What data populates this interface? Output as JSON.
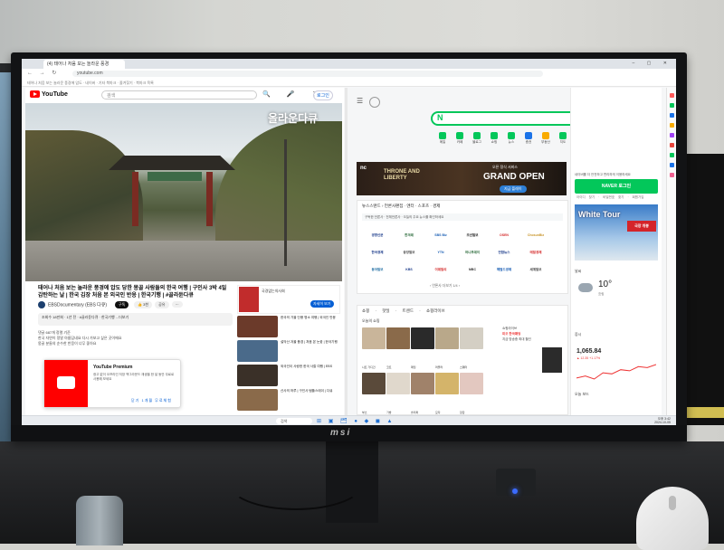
{
  "browser": {
    "tab_title": "(4) 태어나 처음 보는 놀라운 풍경",
    "url": "youtube.com",
    "window_controls": "– ▢ ✕",
    "nav_glyphs": "← → ↻",
    "bookmarks": "테어나 처음 보는 놀라운 풍경에 압도 · 네이버 · 기타 북마크 · 즐겨찾기 · 북마크 목록"
  },
  "youtube": {
    "logo": "YouTube",
    "search_placeholder": "검색",
    "icons": "🔍 🎤 ⋮",
    "login": "로그인",
    "video_overlay": "올라운다큐",
    "video_title": "태어나 처음 보는 놀라운 풍경에 압도 당한 몽골 사람들의 한국 여행 | 구인사 3박 4일 감탄하는 날 | 한국 김장 처음 본 외국인 반응 | 한국기행 | #골라듄다큐",
    "channel_name": "EBSDocumentary (EBS 다큐)",
    "subscribe": "구독",
    "actions": [
      "👍 3천",
      "공유",
      "⋯"
    ],
    "description": "조회수 18만회 · 1년 전 · #골라듄다큐 · 한국기행 ...더보기",
    "comment_lines": [
      "댓글 687개  정렬 기준",
      "한국 자연이 정말 아름답네요 다시 가보고 싶은 곳이에요",
      "몽골 분들의 순수한 반응이 너무 좋아요"
    ],
    "premium": {
      "title": "YouTube Premium",
      "text": "광고 없이 오프라인 저장 백그라운드 재생을 한 달 동안 무료로 사용해 보세요",
      "buttons": "닫기  1개월 무료체험"
    },
    "side_ad": {
      "title": "국경없는의사회",
      "button": "자세히 보기"
    },
    "recommendations": [
      {
        "title": "한국의 가을 단풍 명소 여행 | 외국인 반응",
        "thumb": "#6b3a2a"
      },
      {
        "title": "설악산 겨울 풍경 | 처음 본 눈꽃 | 한국기행",
        "thumb": "#4a6a8a"
      },
      {
        "title": "외국인이 사랑한 한국 사찰 여행 | EBS",
        "thumb": "#3a3028"
      },
      {
        "title": "산사의 하루 | 구인사 템플스테이 | 다큐",
        "thumb": "#8a6a4a"
      }
    ]
  },
  "naver": {
    "search_logo": "N",
    "shortcuts": [
      "메일",
      "카페",
      "블로그",
      "쇼핑",
      "뉴스",
      "증권",
      "부동산",
      "지도",
      "웹툰"
    ],
    "banner": {
      "brand": "nc",
      "game": "THRONE AND LIBERTY",
      "subtitle": "오픈 정식 서비스",
      "headline": "GRAND OPEN",
      "button": "지금 플레이"
    },
    "news_header": "뉴스스탠드 › 언론사편집 · 엔터 · 스포츠 · 경제",
    "news_subline": "구독한 언론사 · 전체언론사 · 오늘의 주요 뉴스를 확인하세요",
    "news_pager": "‹ 언론사 더보기 1/4 ›",
    "news_outlets": [
      {
        "name": "경향신문",
        "color": "#1a3a8a"
      },
      {
        "name": "한겨레",
        "color": "#2a6a3a"
      },
      {
        "name": "SBS Biz",
        "color": "#1b5fb5"
      },
      {
        "name": "조선일보",
        "color": "#111111"
      },
      {
        "name": "OSEN",
        "color": "#d42a2a"
      },
      {
        "name": "ChosunBiz",
        "color": "#c8952a"
      },
      {
        "name": "한국경제",
        "color": "#1a3a8a"
      },
      {
        "name": "중앙일보",
        "color": "#444444"
      },
      {
        "name": "YTN",
        "color": "#1b5fb5"
      },
      {
        "name": "머니투데이",
        "color": "#2a6a3a"
      },
      {
        "name": "연합뉴스",
        "color": "#1a3a8a"
      },
      {
        "name": "매일경제",
        "color": "#d42a2a"
      },
      {
        "name": "동아일보",
        "color": "#1a6aa0"
      },
      {
        "name": "KBS",
        "color": "#1a3a8a"
      },
      {
        "name": "이데일리",
        "color": "#d42a2a"
      },
      {
        "name": "MBC",
        "color": "#333333"
      },
      {
        "name": "헤럴드경제",
        "color": "#1b5fb5"
      },
      {
        "name": "세계일보",
        "color": "#444444"
      }
    ],
    "shop_tabs": "쇼핑 · 핫딜 · 트렌드 · 쇼핑라이브",
    "shop_today": "오늘의 쇼핑",
    "shop_items": [
      {
        "color": "#c9b59a",
        "label": "니트 가디건"
      },
      {
        "color": "#8a6a4a",
        "label": "코트"
      },
      {
        "color": "#2a2a2a",
        "label": "패딩"
      },
      {
        "color": "#b9a88a",
        "label": "머플러"
      },
      {
        "color": "#d4cfc4",
        "label": "스웨터"
      },
      {
        "color": "#5a4a3a",
        "label": "부츠"
      },
      {
        "color": "#e0d8cc",
        "label": "가방"
      },
      {
        "color": "#a0826a",
        "label": "슬리퍼"
      },
      {
        "color": "#d4b46a",
        "label": "모자"
      },
      {
        "color": "#e3c8c0",
        "label": "장갑"
      }
    ],
    "shop_right": {
      "title": "쇼핑라이브",
      "price": "미오 한국패딩",
      "text": "지금 방송중 최대 할인"
    },
    "right": {
      "tip": "네이버를 더 안전하고 편리하게 이용하세요",
      "login": "NAVER 로그인",
      "links": "아이디 찾기 · 비밀번호 찾기 · 회원가입",
      "ad_text": "White Tour",
      "ad_tag": "극장 개봉",
      "weather_label": "날씨",
      "temp": "10°",
      "condition": "흐림",
      "stock_label": "증시",
      "stock_value": "1,065.84",
      "stock_change": "▲ 12.35 +1.17%",
      "bottom": "오늘 보드"
    },
    "stock_series": [
      1053,
      1055,
      1052,
      1058,
      1057,
      1061,
      1060,
      1064,
      1063,
      1066
    ]
  },
  "rail_colors": [
    "#ff5b5b",
    "#03c75a",
    "#1b73e8",
    "#f9ab00",
    "#a142f4",
    "#e8453c",
    "#03c75a",
    "#1b73e8",
    "#f06292"
  ],
  "taskbar": {
    "search": "검색",
    "icons": "⊞ ▣ 🗂 ● ◆ ◼ ▲",
    "time": "오후 3:42",
    "date": "2024-10-05"
  },
  "monitor_brand": "msi"
}
